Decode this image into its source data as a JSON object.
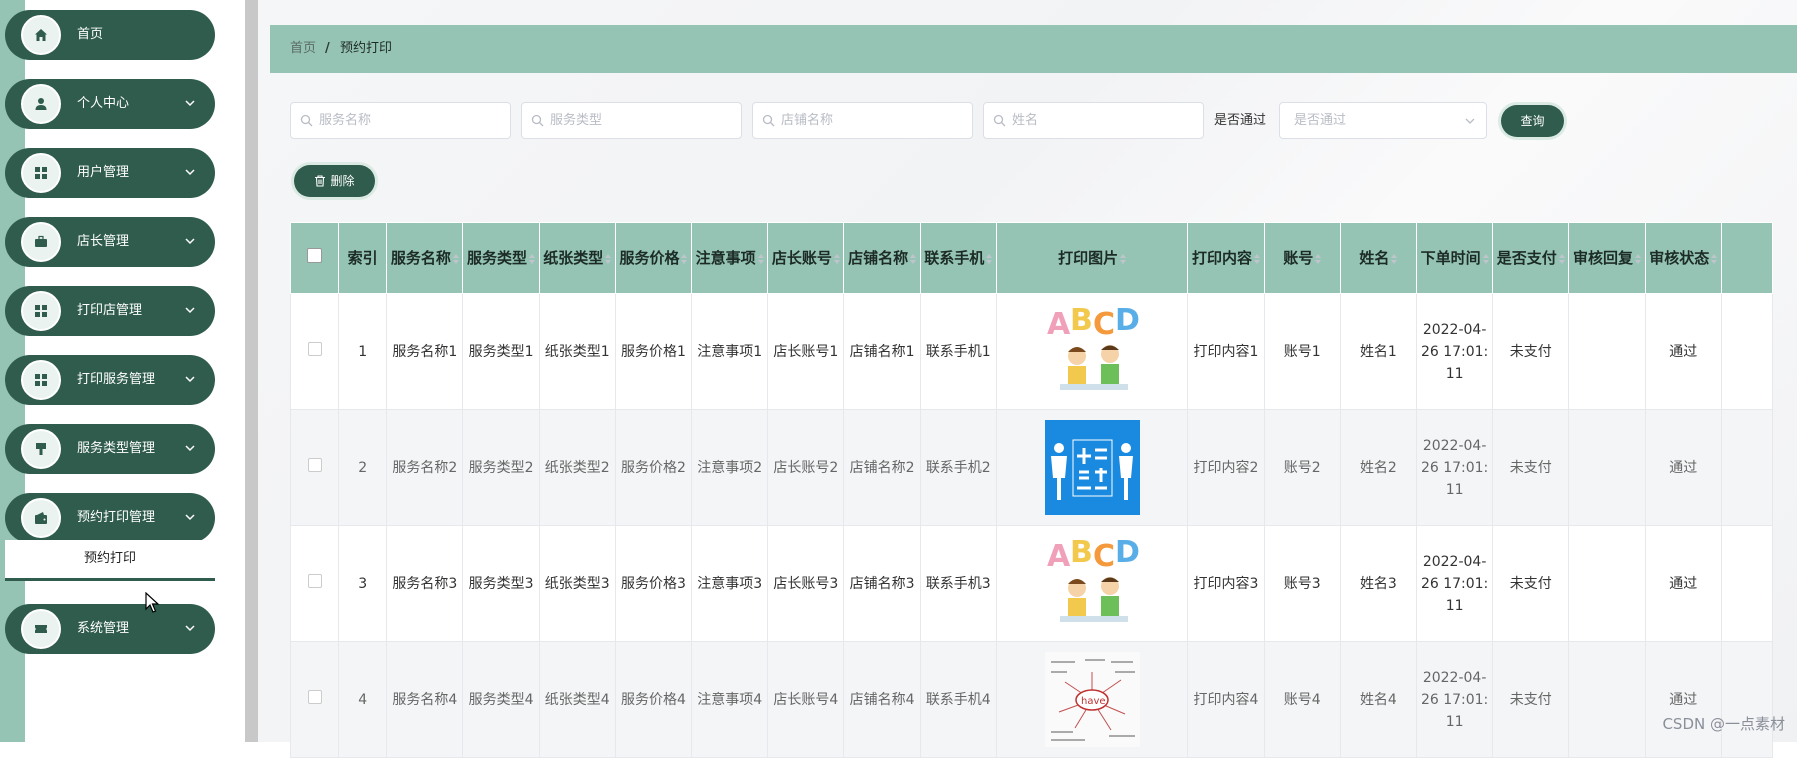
{
  "sidebar": {
    "items": [
      {
        "label": "首页",
        "icon": "home-icon",
        "has_arrow": false
      },
      {
        "label": "个人中心",
        "icon": "person-icon",
        "has_arrow": true
      },
      {
        "label": "用户管理",
        "icon": "grid-icon",
        "has_arrow": true
      },
      {
        "label": "店长管理",
        "icon": "briefcase-icon",
        "has_arrow": true
      },
      {
        "label": "打印店管理",
        "icon": "grid-icon",
        "has_arrow": true
      },
      {
        "label": "打印服务管理",
        "icon": "grid-icon",
        "has_arrow": true
      },
      {
        "label": "服务类型管理",
        "icon": "brush-icon",
        "has_arrow": true
      },
      {
        "label": "预约打印管理",
        "icon": "wallet-icon",
        "has_arrow": true
      },
      {
        "label": "系统管理",
        "icon": "ticket-icon",
        "has_arrow": true
      }
    ],
    "submenu_active": "预约打印"
  },
  "breadcrumb": {
    "home": "首页",
    "separator": "/",
    "current": "预约打印"
  },
  "filters": {
    "service_name_placeholder": "服务名称",
    "service_type_placeholder": "服务类型",
    "shop_name_placeholder": "店铺名称",
    "name_placeholder": "姓名",
    "approved_label": "是否通过",
    "approved_select_placeholder": "是否通过",
    "query_button": "查询"
  },
  "toolbar": {
    "delete_button": "删除"
  },
  "table": {
    "headers": [
      "索引",
      "服务名称",
      "服务类型",
      "纸张类型",
      "服务价格",
      "注意事项",
      "店长账号",
      "店铺名称",
      "联系手机",
      "打印图片",
      "打印内容",
      "账号",
      "姓名",
      "下单时间",
      "是否支付",
      "审核回复",
      "审核状态"
    ],
    "rows": [
      {
        "index": "1",
        "service_name": "服务名称1",
        "service_type": "服务类型1",
        "paper_type": "纸张类型1",
        "price": "服务价格1",
        "notes": "注意事项1",
        "manager_account": "店长账号1",
        "shop_name": "店铺名称1",
        "phone": "联系手机1",
        "image": "abcd-kids-image",
        "content": "打印内容1",
        "account": "账号1",
        "name": "姓名1",
        "order_time": "2022-04-26 17:01:11",
        "paid": "未支付",
        "reply": "",
        "status": "通过"
      },
      {
        "index": "2",
        "service_name": "服务名称2",
        "service_type": "服务类型2",
        "paper_type": "纸张类型2",
        "price": "服务价格2",
        "notes": "注意事项2",
        "manager_account": "店长账号2",
        "shop_name": "店铺名称2",
        "phone": "联系手机2",
        "image": "english-book-image",
        "content": "打印内容2",
        "account": "账号2",
        "name": "姓名2",
        "order_time": "2022-04-26 17:01:11",
        "paid": "未支付",
        "reply": "",
        "status": "通过"
      },
      {
        "index": "3",
        "service_name": "服务名称3",
        "service_type": "服务类型3",
        "paper_type": "纸张类型3",
        "price": "服务价格3",
        "notes": "注意事项3",
        "manager_account": "店长账号3",
        "shop_name": "店铺名称3",
        "phone": "联系手机3",
        "image": "abcd-kids-image",
        "content": "打印内容3",
        "account": "账号3",
        "name": "姓名3",
        "order_time": "2022-04-26 17:01:11",
        "paid": "未支付",
        "reply": "",
        "status": "通过"
      },
      {
        "index": "4",
        "service_name": "服务名称4",
        "service_type": "服务类型4",
        "paper_type": "纸张类型4",
        "price": "服务价格4",
        "notes": "注意事项4",
        "manager_account": "店长账号4",
        "shop_name": "店铺名称4",
        "phone": "联系手机4",
        "image": "have-mindmap-image",
        "content": "打印内容4",
        "account": "账号4",
        "name": "姓名4",
        "order_time": "2022-04-26 17:01:11",
        "paid": "未支付",
        "reply": "",
        "status": "通过"
      }
    ]
  },
  "watermark": "CSDN @一点素材",
  "colors": {
    "sidebar_item": "#2f5c4c",
    "header_bg": "#95c4b5",
    "accent": "#2f5c4c"
  }
}
